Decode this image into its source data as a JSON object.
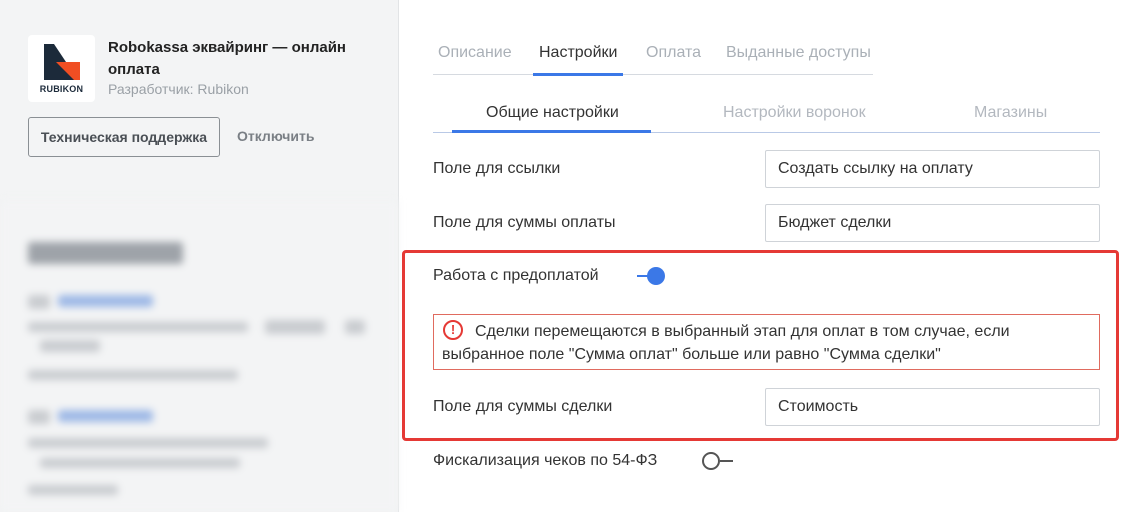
{
  "app": {
    "logo_text": "RUBIKON",
    "title": "Robokassa эквайринг — онлайн оплата",
    "developer": "Разработчик: Rubikon",
    "support_button": "Техническая поддержка",
    "disable_button": "Отключить"
  },
  "tabs": [
    "Описание",
    "Настройки",
    "Оплата",
    "Выданные доступы"
  ],
  "subtabs": [
    "Общие настройки",
    "Настройки воронок",
    "Магазины"
  ],
  "settings": {
    "link_field_label": "Поле для ссылки",
    "link_field_value": "Создать ссылку на оплату",
    "payment_sum_label": "Поле для суммы оплаты",
    "payment_sum_value": "Бюджет сделки",
    "prepayment_label": "Работа с предоплатой",
    "prepayment_enabled": true,
    "warning_icon": "!",
    "warning_text": "Сделки перемещаются в выбранный этап для оплат в том случае, если выбранное поле \"Сумма оплат\" больше или равно \"Сумма сделки\"",
    "deal_sum_label": "Поле для суммы сделки",
    "deal_sum_value": "Стоимость",
    "fiscal_label": "Фискализация чеков по 54-ФЗ",
    "fiscal_enabled": false
  },
  "colors": {
    "accent": "#3b78e7",
    "highlight": "#e53935"
  }
}
